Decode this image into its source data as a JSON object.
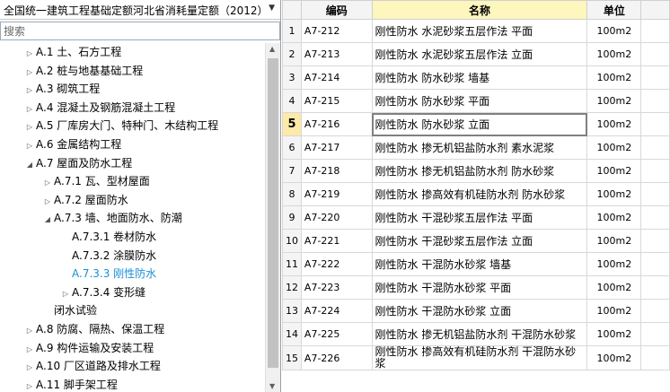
{
  "quota_selector": {
    "value": "全国统一建筑工程基础定额河北省消耗量定额（2012）"
  },
  "search": {
    "placeholder": "搜索"
  },
  "tree": [
    {
      "toggle": "▷",
      "label": "A.1  土、石方工程",
      "level": 0
    },
    {
      "toggle": "▷",
      "label": "A.2  桩与地基基础工程",
      "level": 0
    },
    {
      "toggle": "▷",
      "label": "A.3  砌筑工程",
      "level": 0
    },
    {
      "toggle": "▷",
      "label": "A.4  混凝土及钢筋混凝土工程",
      "level": 0
    },
    {
      "toggle": "▷",
      "label": "A.5  厂库房大门、特种门、木结构工程",
      "level": 0
    },
    {
      "toggle": "▷",
      "label": "A.6  金属结构工程",
      "level": 0
    },
    {
      "toggle": "◢",
      "label": "A.7  屋面及防水工程",
      "level": 0
    },
    {
      "toggle": "▷",
      "label": "A.7.1  瓦、型材屋面",
      "level": 1
    },
    {
      "toggle": "▷",
      "label": "A.7.2  屋面防水",
      "level": 1
    },
    {
      "toggle": "◢",
      "label": "A.7.3  墙、地面防水、防潮",
      "level": 1
    },
    {
      "toggle": "",
      "label": "A.7.3.1  卷材防水",
      "level": 2
    },
    {
      "toggle": "",
      "label": "A.7.3.2  涂膜防水",
      "level": 2
    },
    {
      "toggle": "",
      "label": "A.7.3.3  刚性防水",
      "level": 2,
      "selected": true
    },
    {
      "toggle": "▷",
      "label": "A.7.3.4  变形缝",
      "level": 2
    },
    {
      "toggle": "",
      "label": "闭水试验",
      "level": 1
    },
    {
      "toggle": "▷",
      "label": "A.8  防腐、隔热、保温工程",
      "level": 0
    },
    {
      "toggle": "▷",
      "label": "A.9  构件运输及安装工程",
      "level": 0
    },
    {
      "toggle": "▷",
      "label": "A.10  厂区道路及排水工程",
      "level": 0
    },
    {
      "toggle": "▷",
      "label": "A.11  脚手架工程",
      "level": 0
    }
  ],
  "table": {
    "headers": {
      "code": "编码",
      "name": "名称",
      "unit": "单位"
    },
    "current_row": 5,
    "rows": [
      {
        "idx": "1",
        "code": "A7-212",
        "name": "刚性防水 水泥砂浆五层作法 平面",
        "unit": "100m2"
      },
      {
        "idx": "2",
        "code": "A7-213",
        "name": "刚性防水 水泥砂浆五层作法 立面",
        "unit": "100m2"
      },
      {
        "idx": "3",
        "code": "A7-214",
        "name": "刚性防水 防水砂浆 墙基",
        "unit": "100m2"
      },
      {
        "idx": "4",
        "code": "A7-215",
        "name": "刚性防水 防水砂浆 平面",
        "unit": "100m2"
      },
      {
        "idx": "5",
        "code": "A7-216",
        "name": "刚性防水 防水砂浆 立面",
        "unit": "100m2"
      },
      {
        "idx": "6",
        "code": "A7-217",
        "name": "刚性防水 掺无机铝盐防水剂 素水泥浆",
        "unit": "100m2"
      },
      {
        "idx": "7",
        "code": "A7-218",
        "name": "刚性防水 掺无机铝盐防水剂 防水砂浆",
        "unit": "100m2"
      },
      {
        "idx": "8",
        "code": "A7-219",
        "name": "刚性防水 掺高效有机硅防水剂 防水砂浆",
        "unit": "100m2"
      },
      {
        "idx": "9",
        "code": "A7-220",
        "name": "刚性防水 干混砂浆五层作法 平面",
        "unit": "100m2"
      },
      {
        "idx": "10",
        "code": "A7-221",
        "name": "刚性防水 干混砂浆五层作法 立面",
        "unit": "100m2"
      },
      {
        "idx": "11",
        "code": "A7-222",
        "name": "刚性防水 干混防水砂浆 墙基",
        "unit": "100m2"
      },
      {
        "idx": "12",
        "code": "A7-223",
        "name": "刚性防水 干混防水砂浆 平面",
        "unit": "100m2"
      },
      {
        "idx": "13",
        "code": "A7-224",
        "name": "刚性防水 干混防水砂浆 立面",
        "unit": "100m2"
      },
      {
        "idx": "14",
        "code": "A7-225",
        "name": "刚性防水 掺无机铝盐防水剂 干混防水砂浆",
        "unit": "100m2"
      },
      {
        "idx": "15",
        "code": "A7-226",
        "name": "刚性防水 掺高效有机硅防水剂 干混防水砂浆",
        "unit": "100m2"
      }
    ]
  }
}
